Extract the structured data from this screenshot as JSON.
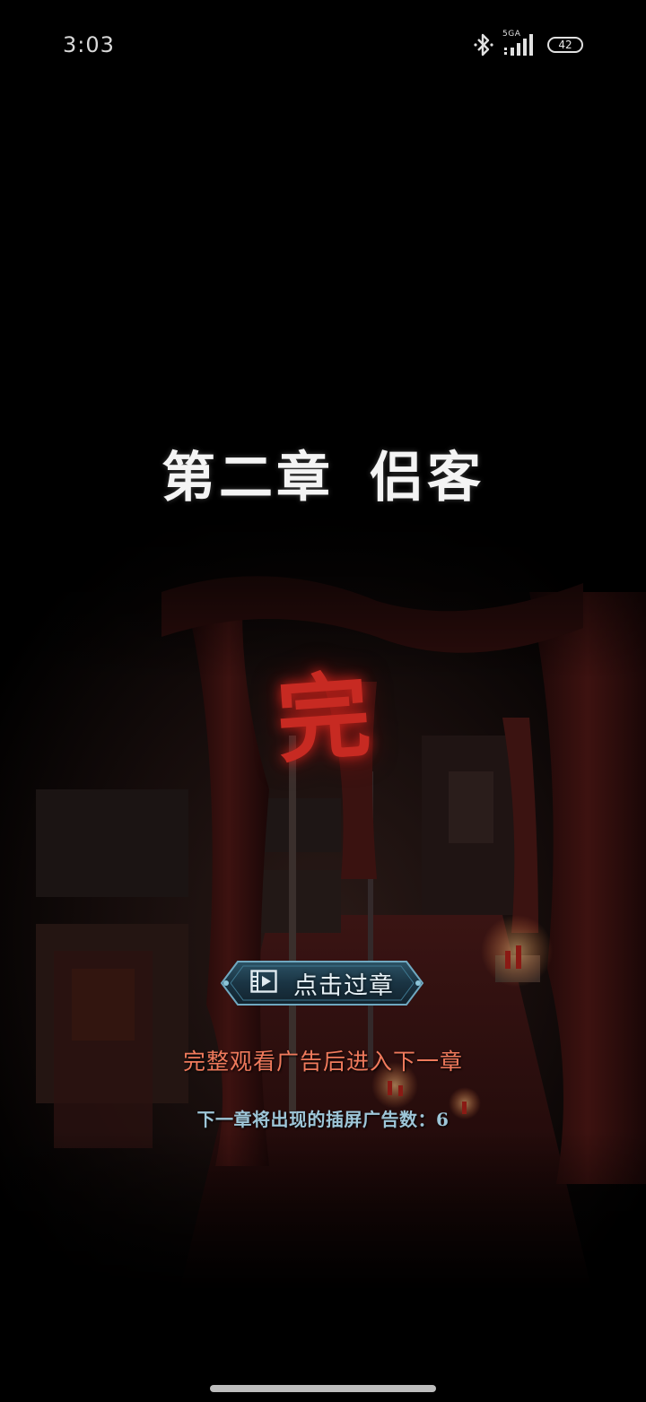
{
  "status_bar": {
    "time": "3:03",
    "network_label": "5GA",
    "battery_level": "42",
    "icons": [
      "bluetooth-icon",
      "signal-icon",
      "battery-icon"
    ]
  },
  "chapter": {
    "number_title": "第二章",
    "name": "侣客"
  },
  "end_stamp": "完",
  "skip_button": {
    "label": "点击过章",
    "icon": "video-ad-icon"
  },
  "ad_note": "完整观看广告后进入下一章",
  "ad_count_text": "下一章将出现的插屏广告数：6",
  "colors": {
    "background": "#000000",
    "stamp_red": "#c72a22",
    "note_orange": "#f07a5c",
    "count_blue": "#9ec6d8",
    "button_teal": "#1d3a4a"
  }
}
